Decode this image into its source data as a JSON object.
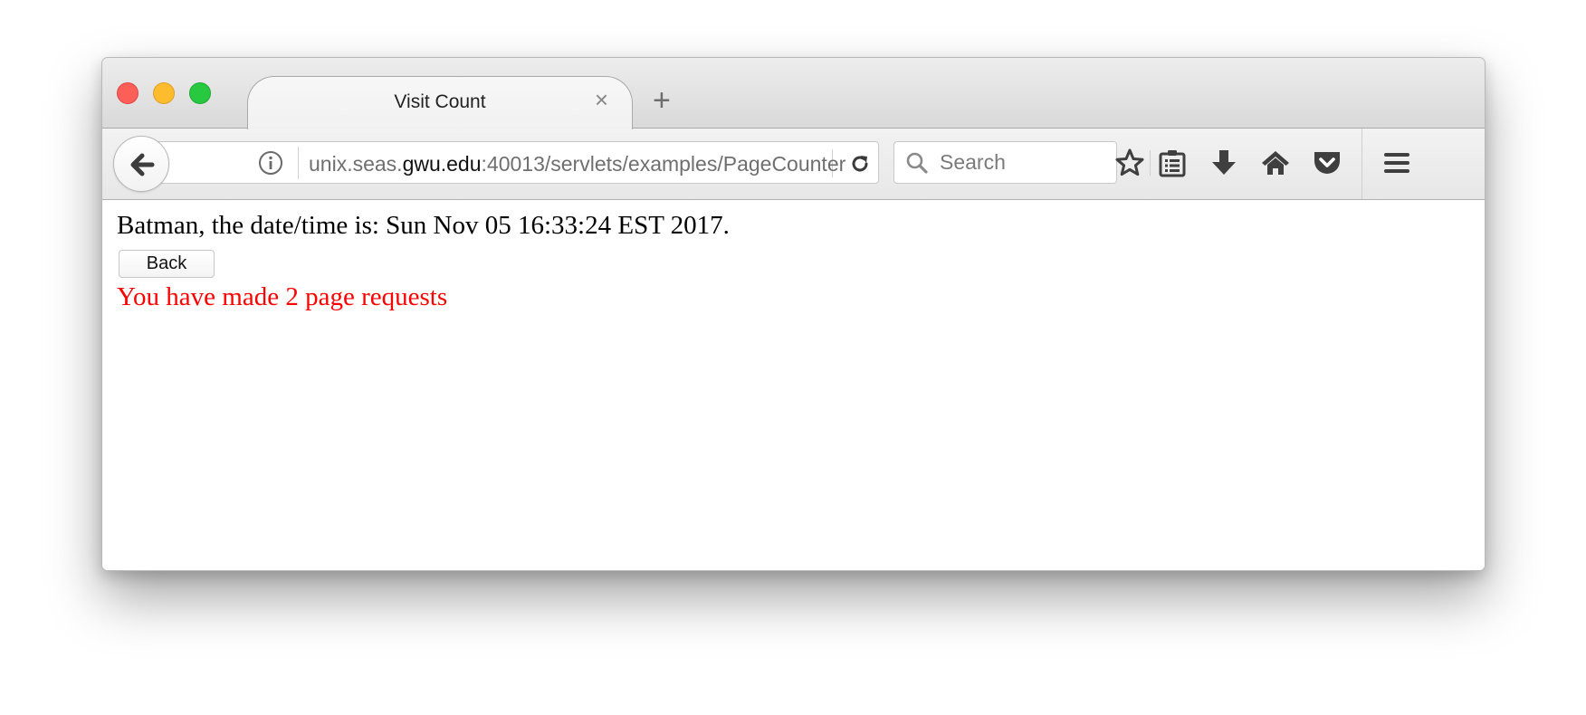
{
  "colors": {
    "red_text": "#ff0000",
    "traffic_close": "#fc5f57",
    "traffic_minimize": "#fdbc2e",
    "traffic_zoom": "#28c840"
  },
  "window": {
    "controls": [
      "close",
      "minimize",
      "zoom"
    ]
  },
  "tabs": [
    {
      "title": "Visit Count",
      "close_glyph": "×",
      "active": true
    }
  ],
  "new_tab_glyph": "+",
  "navbar": {
    "url": {
      "subdomain": "unix.seas.",
      "domain": "gwu.edu",
      "path": ":40013/servlets/examples/PageCounter"
    },
    "search": {
      "placeholder": "Search",
      "value": ""
    },
    "icons": [
      "back-arrow-icon",
      "info-icon",
      "reload-icon",
      "search-icon",
      "star-icon",
      "reading-list-icon",
      "download-icon",
      "home-icon",
      "pocket-icon",
      "hamburger-menu-icon"
    ]
  },
  "page": {
    "greeting": "Batman, the date/time is: Sun Nov 05 16:33:24 EST 2017.",
    "back_button": "Back",
    "request_count_message": "You have made 2 page requests"
  }
}
